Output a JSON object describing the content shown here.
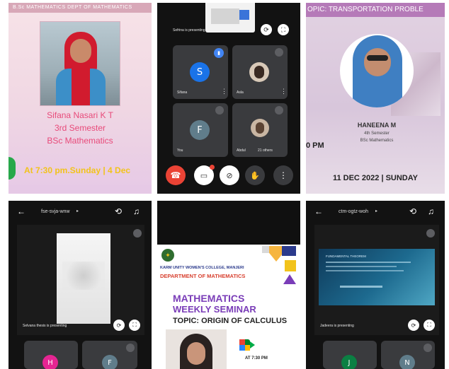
{
  "tile1": {
    "top_banner": "B.Sc MATHEMATICS DEPT OF MATHEMATICS",
    "name": "Sifana Nasari K T",
    "semester": "3rd Semester",
    "course": "BSc Mathematics",
    "time": "At 7:30 pm.Sunday | 4 Dec"
  },
  "tile2": {
    "presenting": "Sefrina is presenting",
    "participants": [
      "Sifana",
      "Asla",
      "You",
      "Abdul"
    ],
    "initials": [
      "S",
      "",
      "F",
      ""
    ],
    "others": "21 others"
  },
  "tile3": {
    "banner": "OPIC: TRANSPORTATION PROBLE",
    "name": "HANEENA M",
    "semester": "4th Semester",
    "course": "BSc Mathematics",
    "pm": "0 PM",
    "date": "11 DEC 2022 | SUNDAY"
  },
  "tile4": {
    "meeting_code": "fse-svja-wnw",
    "presenting": "Selvana thesis is presenting",
    "initials": [
      "H",
      "F"
    ]
  },
  "tile5": {
    "college": "KARM UNITY WOMEN'S COLLEGE, MANJERI",
    "department": "DEPARTMENT OF MATHEMATICS",
    "title1": "MATHEMATICS",
    "title2": "WEEKLY SEMINAR",
    "topic": "TOPIC: ORIGIN OF CALCULUS",
    "time": "AT 7:30 PM"
  },
  "tile6": {
    "meeting_code": "ctm-ogtz-woh",
    "slide_title": "FUNDAMENTAL THEOREM",
    "presenting": "Jadeera is presenting",
    "initials": [
      "J",
      "N"
    ]
  },
  "colors": {
    "pink": "#e84a7a",
    "yellow": "#f2c31b",
    "purple": "#7a3db8",
    "meet_red": "#ea4335",
    "dark": "#121212"
  }
}
